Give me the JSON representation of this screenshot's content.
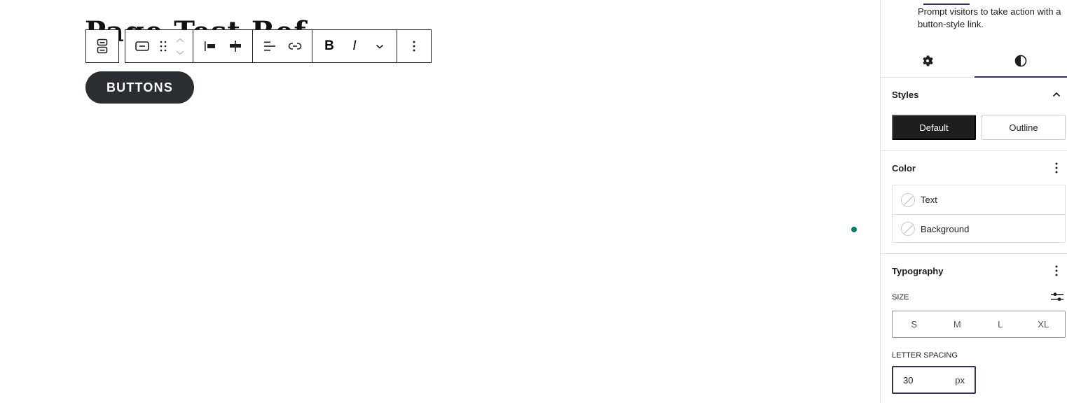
{
  "canvas": {
    "heading_partial": "Page Test Ref",
    "button_preview_label": "BUTTONS"
  },
  "toolbar": {
    "parent_selector": "select-parent-buttons",
    "groups": [
      [
        "button-block-icon",
        "drag-handle-icon",
        "move-up-icon",
        "move-down-icon"
      ],
      [
        "justify-left-icon",
        "justify-center-icon"
      ],
      [
        "text-align-icon",
        "link-icon"
      ],
      [
        "bold-icon",
        "italic-icon",
        "more-rich-text-icon"
      ],
      [
        "options-icon"
      ]
    ],
    "bold_label": "B",
    "italic_label": "I"
  },
  "sidebar": {
    "block_description": "Prompt visitors to take action with a button-style link.",
    "tabs": [
      {
        "name": "settings",
        "icon": "gear-icon",
        "active": false
      },
      {
        "name": "styles",
        "icon": "contrast-icon",
        "active": true
      }
    ],
    "styles": {
      "title": "Styles",
      "options": [
        "Default",
        "Outline"
      ],
      "selected": "Default"
    },
    "color": {
      "title": "Color",
      "items": [
        "Text",
        "Background"
      ]
    },
    "typography": {
      "title": "Typography",
      "size_label": "SIZE",
      "size_options": [
        "S",
        "M",
        "L",
        "XL"
      ],
      "letter_spacing_label": "LETTER SPACING",
      "letter_spacing_value": "30",
      "letter_spacing_unit": "px"
    }
  },
  "colors": {
    "accent": "#3c2d5c",
    "dark": "#1e1e1e",
    "button_bg": "#2a2e33",
    "status_dot": "#0a7b63"
  }
}
